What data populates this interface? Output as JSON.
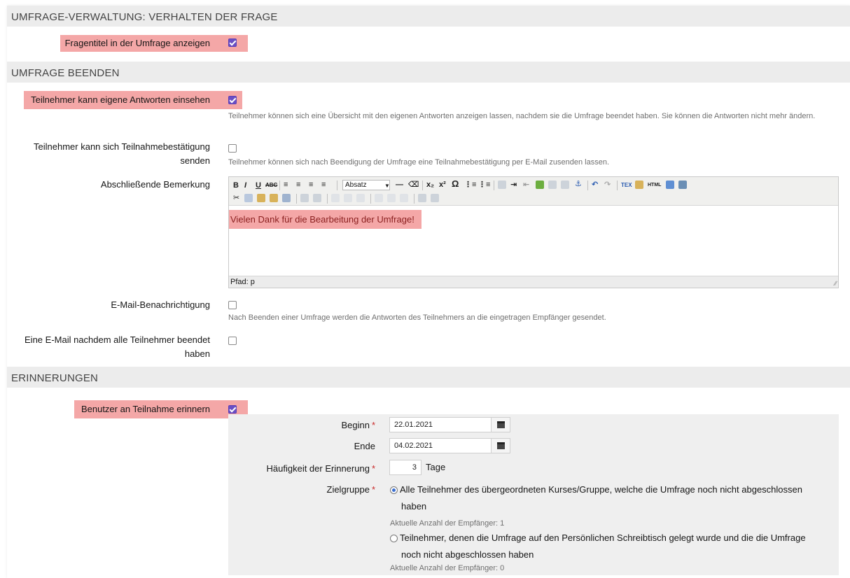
{
  "sections": {
    "behaviour": "UMFRAGE-VERWALTUNG: VERHALTEN DER FRAGE",
    "finish": "UMFRAGE BEENDEN",
    "reminders": "ERINNERUNGEN"
  },
  "behaviour": {
    "show_title_label": "Fragentitel in der Umfrage anzeigen",
    "show_title_checked": true
  },
  "finish": {
    "view_answers_label": "Teilnehmer kann eigene Antworten einsehen",
    "view_answers_help": "Teilnehmer können sich eine Übersicht mit den eigenen Antworten anzeigen lassen, nachdem sie die Umfrage beendet haben. Sie können die Antworten nicht mehr ändern.",
    "confirmation_label_1": "Teilnehmer kann sich Teilnahmebestätigung",
    "confirmation_label_2": "senden",
    "confirmation_help": "Teilnehmer können sich nach Beendigung der Umfrage eine Teilnahmebestätigung per E-Mail zusenden lassen.",
    "closing_remark_label": "Abschließende Bemerkung",
    "editor": {
      "format_select": "Absatz",
      "content": "Vielen Dank für die Bearbeitung der Umfrage!",
      "status": "Pfad: p"
    },
    "email_notify_label": "E-Mail-Benachrichtigung",
    "email_notify_help": "Nach Beenden einer Umfrage werden die Antworten des Teilnehmers an die eingetragen Empfänger gesendet.",
    "email_all_label_1": "Eine E-Mail nachdem alle Teilnehmer beendet",
    "email_all_label_2": "haben"
  },
  "reminders": {
    "remind_label": "Benutzer an Teilnahme erinnern",
    "begin_label": "Beginn",
    "begin_value": "22.01.2021",
    "end_label": "Ende",
    "end_value": "04.02.2021",
    "frequency_label": "Häufigkeit der Erinnerung",
    "frequency_value": "3",
    "frequency_unit": "Tage",
    "target_label": "Zielgruppe",
    "required_mark": "*",
    "option1_line1": "Alle Teilnehmer des übergeordneten Kurses/Gruppe, welche die Umfrage noch nicht abgeschlossen",
    "option1_line2": "haben",
    "option1_count": "Aktuelle Anzahl der Empfänger: 1",
    "option2_line1": "Teilnehmer, denen die Umfrage auf den Persönlichen Schreibtisch gelegt wurde und die die Umfrage",
    "option2_line2": "noch nicht abgeschlossen haben",
    "option2_count": "Aktuelle Anzahl der Empfänger: 0"
  }
}
